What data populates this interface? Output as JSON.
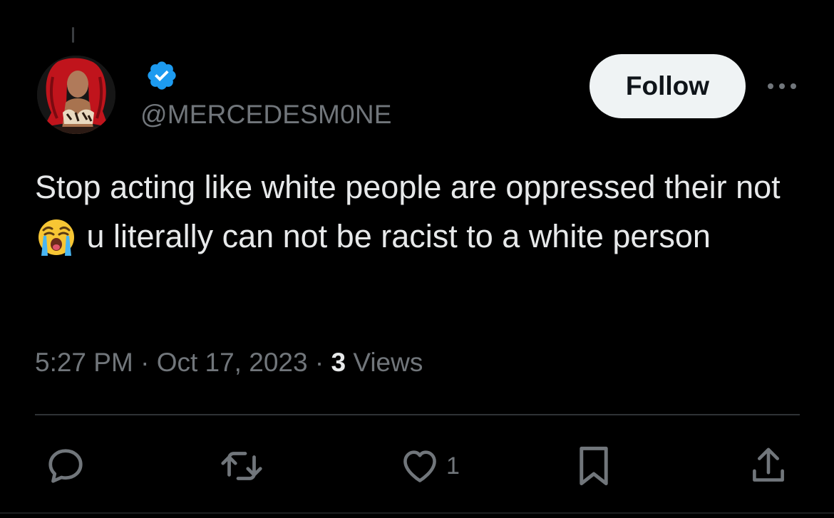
{
  "tweet": {
    "handle": "@MERCEDESM0NE",
    "follow_label": "Follow",
    "text_part1": "Stop acting like white people are oppressed their not ",
    "emoji": "loudly-crying-face-emoji",
    "text_part2": " u literally can not be racist to a white person",
    "time": "5:27 PM",
    "date": "Oct 17, 2023",
    "separator": "·",
    "views_count": "3",
    "views_label": "Views",
    "like_count": "1"
  },
  "icons": {
    "verified": "verified-badge-icon",
    "more": "more-options-icon",
    "reply": "reply-icon",
    "retweet": "retweet-icon",
    "like": "like-icon",
    "bookmark": "bookmark-icon",
    "share": "share-icon"
  },
  "colors": {
    "background": "#000000",
    "text_primary": "#e7e9ea",
    "text_secondary": "#71767b",
    "verified_blue": "#1d9bf0",
    "follow_bg": "#eff3f4",
    "divider": "#2f3336"
  }
}
